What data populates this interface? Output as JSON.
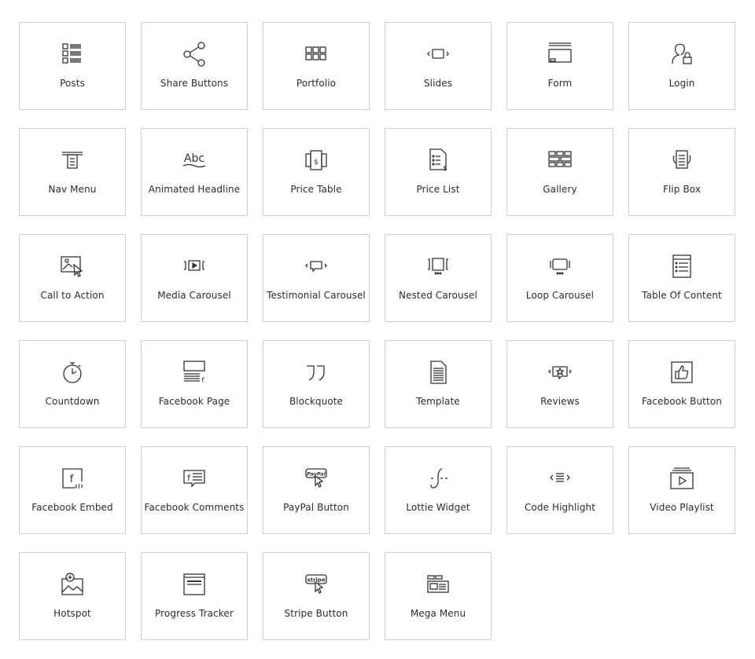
{
  "widgets": [
    {
      "label": "Posts",
      "icon": "posts-icon"
    },
    {
      "label": "Share Buttons",
      "icon": "share-icon"
    },
    {
      "label": "Portfolio",
      "icon": "portfolio-icon"
    },
    {
      "label": "Slides",
      "icon": "slides-icon"
    },
    {
      "label": "Form",
      "icon": "form-icon"
    },
    {
      "label": "Login",
      "icon": "login-icon"
    },
    {
      "label": "Nav Menu",
      "icon": "nav-menu-icon"
    },
    {
      "label": "Animated Headline",
      "icon": "animated-headline-icon"
    },
    {
      "label": "Price Table",
      "icon": "price-table-icon"
    },
    {
      "label": "Price List",
      "icon": "price-list-icon"
    },
    {
      "label": "Gallery",
      "icon": "gallery-icon"
    },
    {
      "label": "Flip Box",
      "icon": "flip-box-icon"
    },
    {
      "label": "Call to Action",
      "icon": "call-to-action-icon"
    },
    {
      "label": "Media Carousel",
      "icon": "media-carousel-icon"
    },
    {
      "label": "Testimonial Carousel",
      "icon": "testimonial-carousel-icon"
    },
    {
      "label": "Nested Carousel",
      "icon": "nested-carousel-icon"
    },
    {
      "label": "Loop Carousel",
      "icon": "loop-carousel-icon"
    },
    {
      "label": "Table Of Content",
      "icon": "table-of-content-icon"
    },
    {
      "label": "Countdown",
      "icon": "countdown-icon"
    },
    {
      "label": "Facebook Page",
      "icon": "facebook-page-icon"
    },
    {
      "label": "Blockquote",
      "icon": "blockquote-icon"
    },
    {
      "label": "Template",
      "icon": "template-icon"
    },
    {
      "label": "Reviews",
      "icon": "reviews-icon"
    },
    {
      "label": "Facebook Button",
      "icon": "facebook-button-icon"
    },
    {
      "label": "Facebook Embed",
      "icon": "facebook-embed-icon"
    },
    {
      "label": "Facebook Comments",
      "icon": "facebook-comments-icon"
    },
    {
      "label": "PayPal Button",
      "icon": "paypal-button-icon"
    },
    {
      "label": "Lottie Widget",
      "icon": "lottie-icon"
    },
    {
      "label": "Code Highlight",
      "icon": "code-highlight-icon"
    },
    {
      "label": "Video Playlist",
      "icon": "video-playlist-icon"
    },
    {
      "label": "Hotspot",
      "icon": "hotspot-icon"
    },
    {
      "label": "Progress Tracker",
      "icon": "progress-tracker-icon"
    },
    {
      "label": "Stripe Button",
      "icon": "stripe-button-icon"
    },
    {
      "label": "Mega Menu",
      "icon": "mega-menu-icon"
    }
  ],
  "icon_text": {
    "abc": "Abc",
    "paypal": "PayPal",
    "stripe": "stripe",
    "f": "f"
  }
}
